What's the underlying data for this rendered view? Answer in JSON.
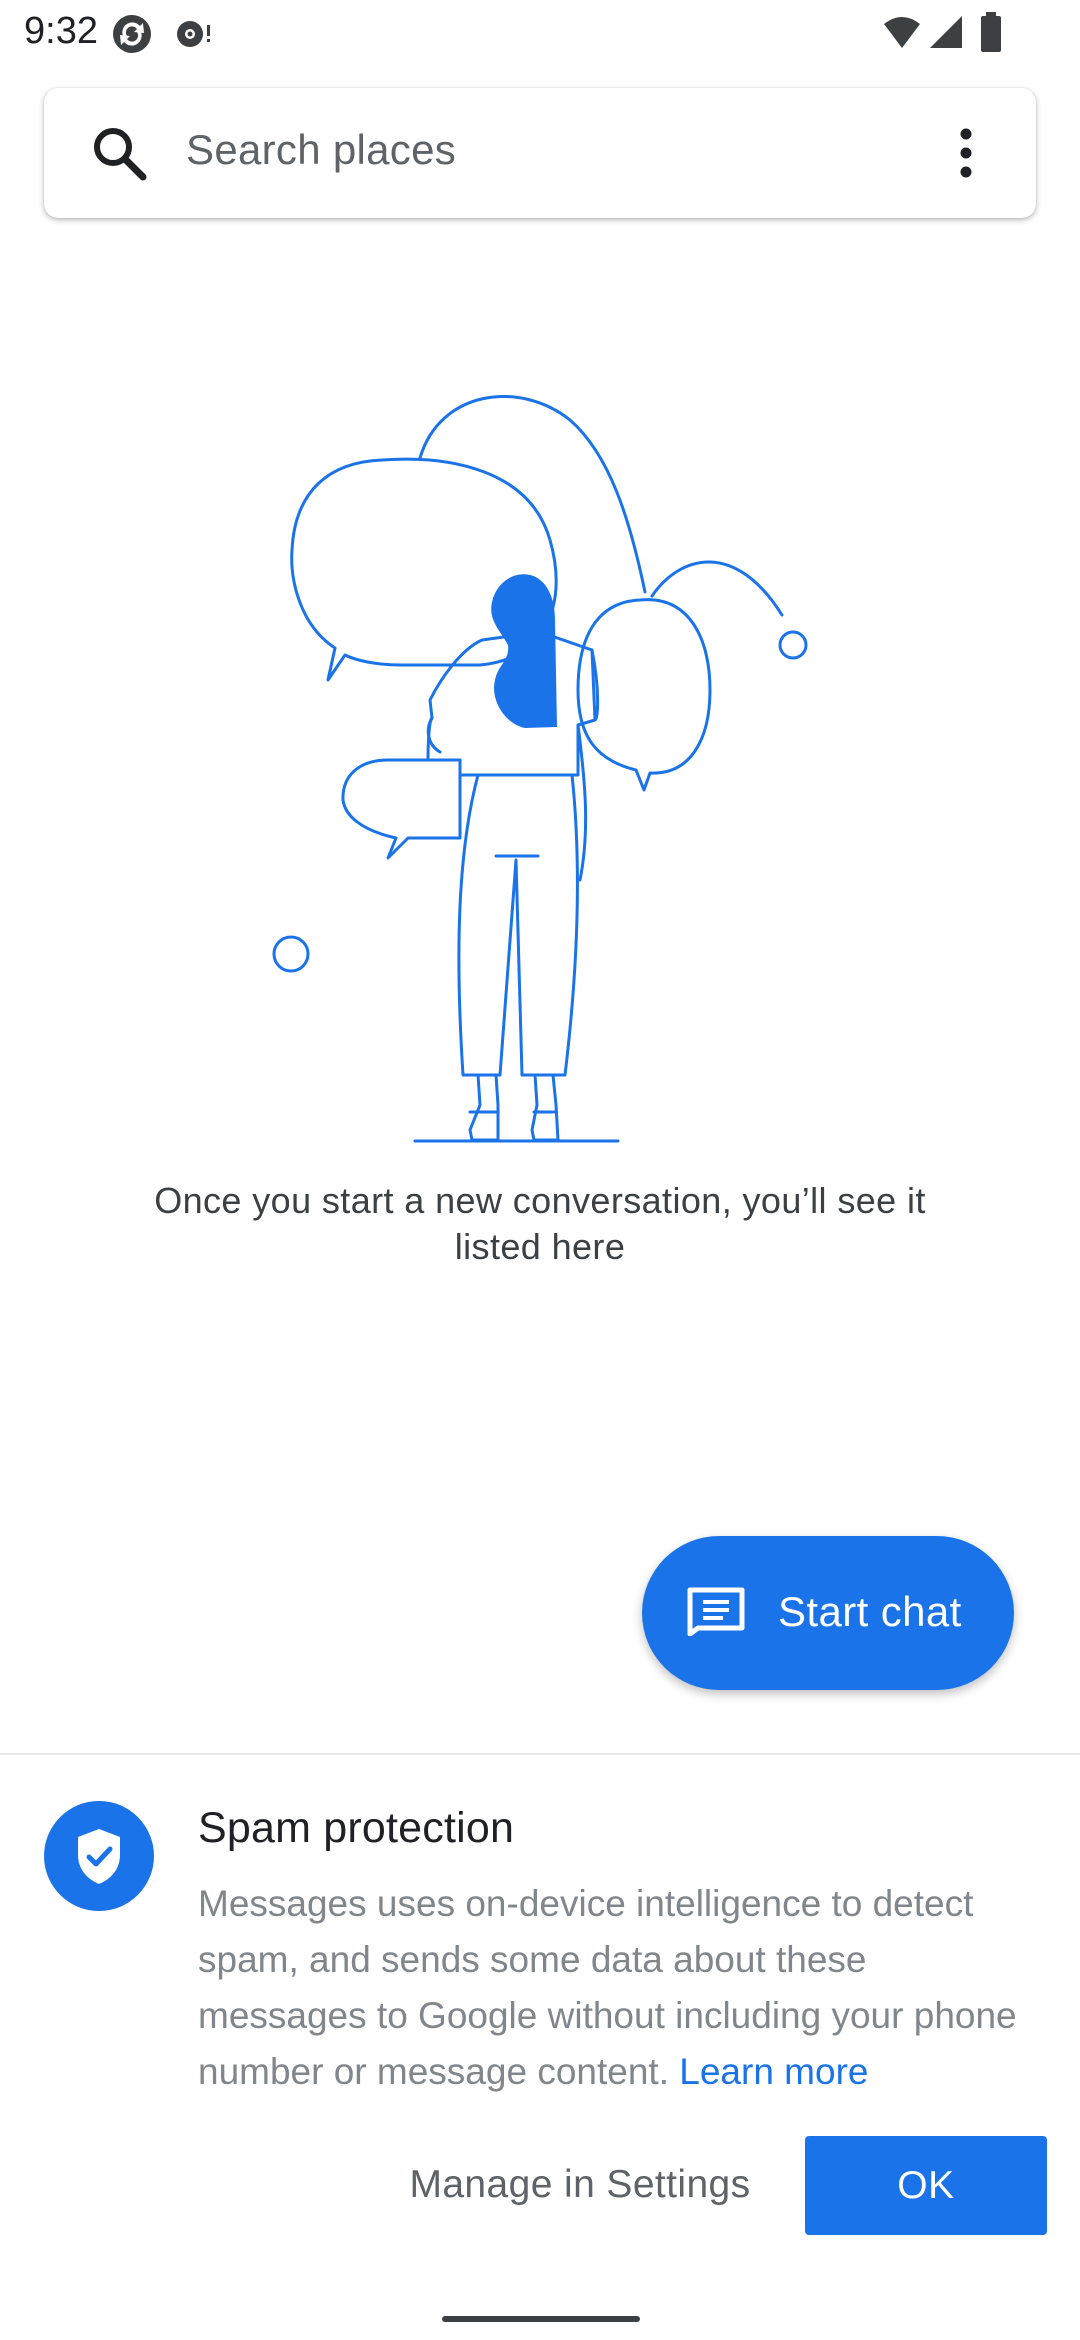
{
  "status_bar": {
    "time": "9:32",
    "icons": [
      "app-notification-icon",
      "podcast-notification-icon",
      "wifi-icon",
      "cellular-signal-icon",
      "battery-icon"
    ]
  },
  "search": {
    "placeholder": "Search places",
    "left_icon": "search-icon",
    "right_icon": "more-vert-icon"
  },
  "empty_state": {
    "message": "Once you start a new conversation, you’ll see it listed here"
  },
  "fab": {
    "label": "Start chat",
    "icon": "chat-message-icon"
  },
  "spam_sheet": {
    "title": "Spam protection",
    "body": "Messages uses on-device intelligence to detect spam, and sends some data about these messages to Google without including your phone number or message content.",
    "link": "Learn more",
    "secondary_button": "Manage in Settings",
    "primary_button": "OK",
    "icon": "shield-check-icon"
  },
  "colors": {
    "accent": "#1a73e8",
    "text_primary": "#202124",
    "text_secondary": "#80868b",
    "background": "#ffffff"
  }
}
